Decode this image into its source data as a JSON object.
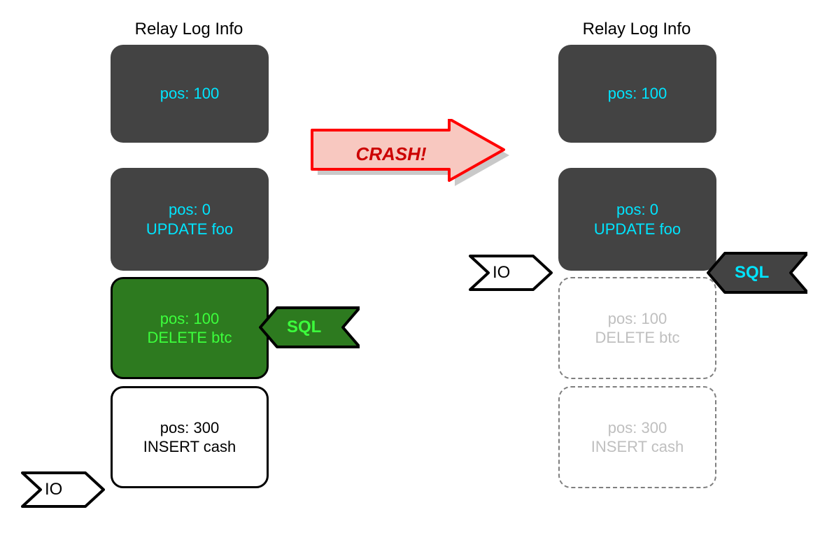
{
  "left": {
    "title": "Relay Log Info",
    "blocks": [
      {
        "l1": "pos: 100",
        "l2": ""
      },
      {
        "l1": "pos: 0",
        "l2": "UPDATE foo"
      },
      {
        "l1": "pos: 100",
        "l2": "DELETE btc"
      },
      {
        "l1": "pos: 300",
        "l2": "INSERT cash"
      }
    ],
    "io_label": "IO",
    "sql_label": "SQL"
  },
  "right": {
    "title": "Relay Log Info",
    "blocks": [
      {
        "l1": "pos: 100",
        "l2": ""
      },
      {
        "l1": "pos: 0",
        "l2": "UPDATE foo"
      },
      {
        "l1": "pos: 100",
        "l2": "DELETE btc"
      },
      {
        "l1": "pos: 300",
        "l2": "INSERT cash"
      }
    ],
    "io_label": "IO",
    "sql_label": "SQL"
  },
  "crash_label": "CRASH!",
  "colors": {
    "dark_bg": "#434343",
    "cyan": "#00e5ff",
    "green_bg": "#2d7a1f",
    "bright_green": "#3cff3c",
    "crash_red": "#cc0000",
    "arrow_fill": "#f8c8c0"
  }
}
